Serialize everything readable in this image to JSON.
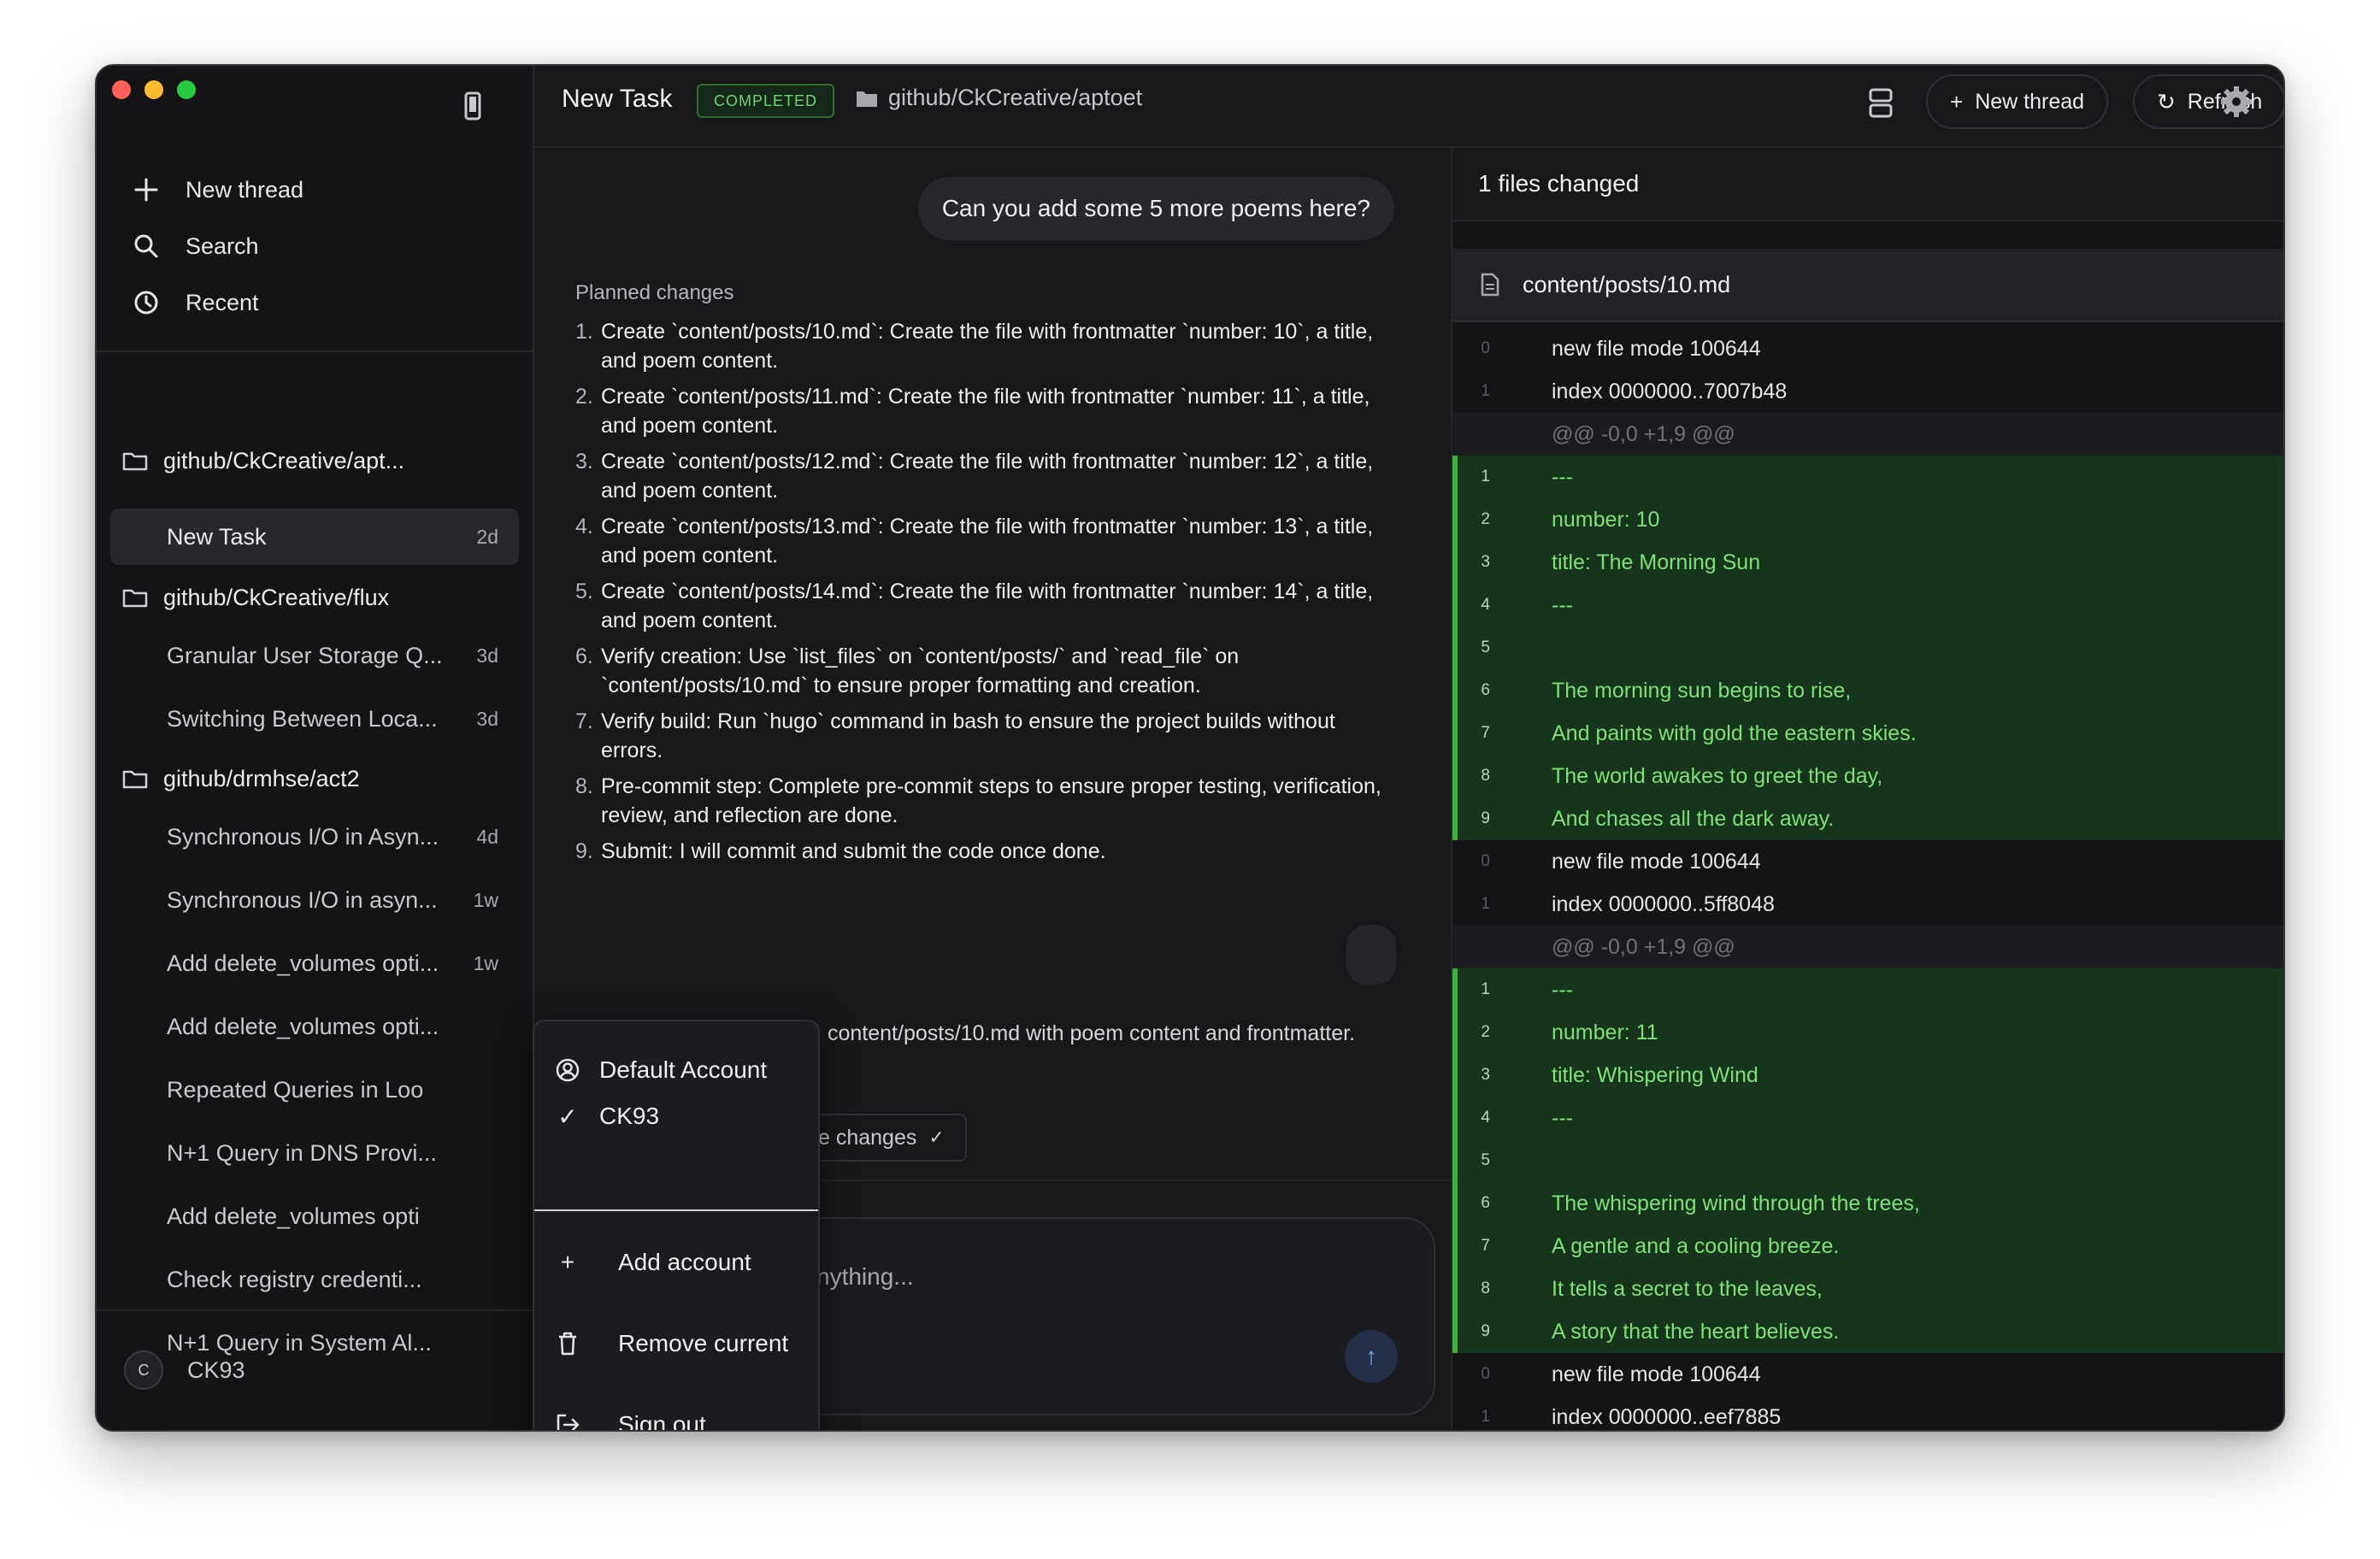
{
  "sidebar": {
    "nav": {
      "new_thread": "New thread",
      "search": "Search",
      "recent": "Recent"
    },
    "groups": [
      {
        "name": "github/CkCreative/apt...",
        "threads": [
          {
            "title": "New Task",
            "age": "2d"
          }
        ]
      },
      {
        "name": "github/CkCreative/flux",
        "threads": [
          {
            "title": "Granular User Storage Q...",
            "age": "3d"
          },
          {
            "title": "Switching Between Loca...",
            "age": "3d"
          }
        ]
      },
      {
        "name": "github/drmhse/act2",
        "threads": [
          {
            "title": "Synchronous I/O in Asyn...",
            "age": "4d"
          },
          {
            "title": "Synchronous I/O in asyn...",
            "age": "1w"
          },
          {
            "title": "Add delete_volumes opti...",
            "age": "1w"
          },
          {
            "title": "Add delete_volumes opti...",
            "age": ""
          },
          {
            "title": "Repeated Queries in Loo",
            "age": ""
          },
          {
            "title": "N+1 Query in DNS Provi...",
            "age": ""
          },
          {
            "title": "Add delete_volumes opti",
            "age": ""
          },
          {
            "title": "Check registry credenti...",
            "age": ""
          },
          {
            "title": "N+1 Query in System Al...",
            "age": ""
          }
        ]
      }
    ],
    "user": {
      "initial": "C",
      "name": "CK93"
    }
  },
  "header": {
    "title": "New Task",
    "status": "COMPLETED",
    "repo": "github/CkCreative/aptoet",
    "new_thread": "New thread",
    "refresh": "Refresh"
  },
  "chat": {
    "user_message": "Can you add some 5 more poems here?",
    "planned_label": "Planned changes",
    "steps": [
      "Create `content/posts/10.md`: Create the file with frontmatter `number: 10`, a title, and poem content.",
      "Create `content/posts/11.md`: Create the file with frontmatter `number: 11`, a title, and poem content.",
      "Create `content/posts/12.md`: Create the file with frontmatter `number: 12`, a title, and poem content.",
      "Create `content/posts/13.md`: Create the file with frontmatter `number: 13`, a title, and poem content.",
      "Create `content/posts/14.md`: Create the file with frontmatter `number: 14`, a title, and poem content.",
      "Verify creation: Use `list_files` on `content/posts/` and `read_file` on `content/posts/10.md` to ensure proper formatting and creation.",
      "Verify build: Run `hugo` command in bash to ensure the project builds without errors.",
      "Pre-commit step: Complete pre-commit steps to ensure proper testing, verification, review, and reflection are done.",
      "Submit: I will commit and submit the code once done."
    ],
    "result_text": "content/posts/10.md with poem content and frontmatter.",
    "changes_label": "e changes",
    "composer_placeholder": "nything..."
  },
  "diff": {
    "summary": "1 files changed",
    "file": "content/posts/10.md",
    "lines": [
      {
        "kind": "meta",
        "n": "0",
        "text": "new file mode 100644"
      },
      {
        "kind": "meta",
        "n": "1",
        "text": "index 0000000..7007b48"
      },
      {
        "kind": "hunk",
        "n": "",
        "text": "@@ -0,0 +1,9 @@"
      },
      {
        "kind": "add",
        "n": "1",
        "text": "---"
      },
      {
        "kind": "add",
        "n": "2",
        "text": "number: 10"
      },
      {
        "kind": "add",
        "n": "3",
        "text": "title: The Morning Sun"
      },
      {
        "kind": "add",
        "n": "4",
        "text": "---"
      },
      {
        "kind": "add",
        "n": "5",
        "text": ""
      },
      {
        "kind": "add",
        "n": "6",
        "text": "The morning sun begins to rise,"
      },
      {
        "kind": "add",
        "n": "7",
        "text": "And paints with gold the eastern skies."
      },
      {
        "kind": "add",
        "n": "8",
        "text": "The world awakes to greet the day,"
      },
      {
        "kind": "add",
        "n": "9",
        "text": "And chases all the dark away."
      },
      {
        "kind": "meta",
        "n": "0",
        "text": "new file mode 100644"
      },
      {
        "kind": "meta",
        "n": "1",
        "text": "index 0000000..5ff8048"
      },
      {
        "kind": "hunk",
        "n": "",
        "text": "@@ -0,0 +1,9 @@"
      },
      {
        "kind": "add",
        "n": "1",
        "text": "---"
      },
      {
        "kind": "add",
        "n": "2",
        "text": "number: 11"
      },
      {
        "kind": "add",
        "n": "3",
        "text": "title: Whispering Wind"
      },
      {
        "kind": "add",
        "n": "4",
        "text": "---"
      },
      {
        "kind": "add",
        "n": "5",
        "text": ""
      },
      {
        "kind": "add",
        "n": "6",
        "text": "The whispering wind through the trees,"
      },
      {
        "kind": "add",
        "n": "7",
        "text": "A gentle and a cooling breeze."
      },
      {
        "kind": "add",
        "n": "8",
        "text": "It tells a secret to the leaves,"
      },
      {
        "kind": "add",
        "n": "9",
        "text": "A story that the heart believes."
      },
      {
        "kind": "meta",
        "n": "0",
        "text": "new file mode 100644"
      },
      {
        "kind": "meta",
        "n": "1",
        "text": "index 0000000..eef7885"
      }
    ]
  },
  "account_menu": {
    "default_account": "Default Account",
    "current_account": "CK93",
    "add_account": "Add account",
    "remove_current": "Remove current",
    "sign_out": "Sign out"
  }
}
